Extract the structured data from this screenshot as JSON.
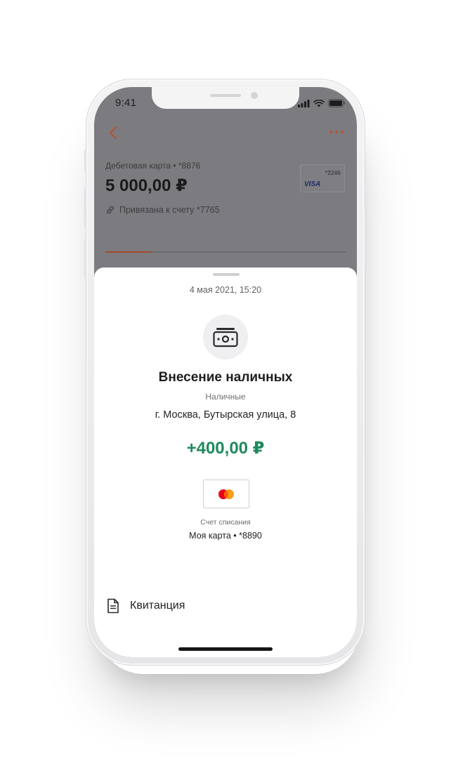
{
  "status_bar": {
    "time": "9:41"
  },
  "account": {
    "card_type": "Дебетовая карта • *8876",
    "balance": "5 000,00 ₽",
    "linked_text": "Привязана к счету  *7765",
    "mini_card": {
      "number": "*2246",
      "brand": "VISA"
    },
    "tab_progress": 0.19
  },
  "transaction": {
    "date": "4 мая 2021, 15:20",
    "title": "Внесение наличных",
    "category": "Наличные",
    "address": "г. Москва, Бутырская улица, 8",
    "amount": "+400,00 ₽",
    "debit_account_label": "Счет списания",
    "debit_account_value": "Моя карта • *8890",
    "receipt_label": "Квитанция"
  },
  "colors": {
    "accent": "#c8572c",
    "amount_positive": "#1f8a5f",
    "overlay": "#7c7c80"
  },
  "icons": {
    "back": "chevron-left-icon",
    "more": "more-dots-icon",
    "link": "link-icon",
    "operation": "cash-icon",
    "card_brand": "mastercard-icon",
    "receipt": "document-icon"
  }
}
